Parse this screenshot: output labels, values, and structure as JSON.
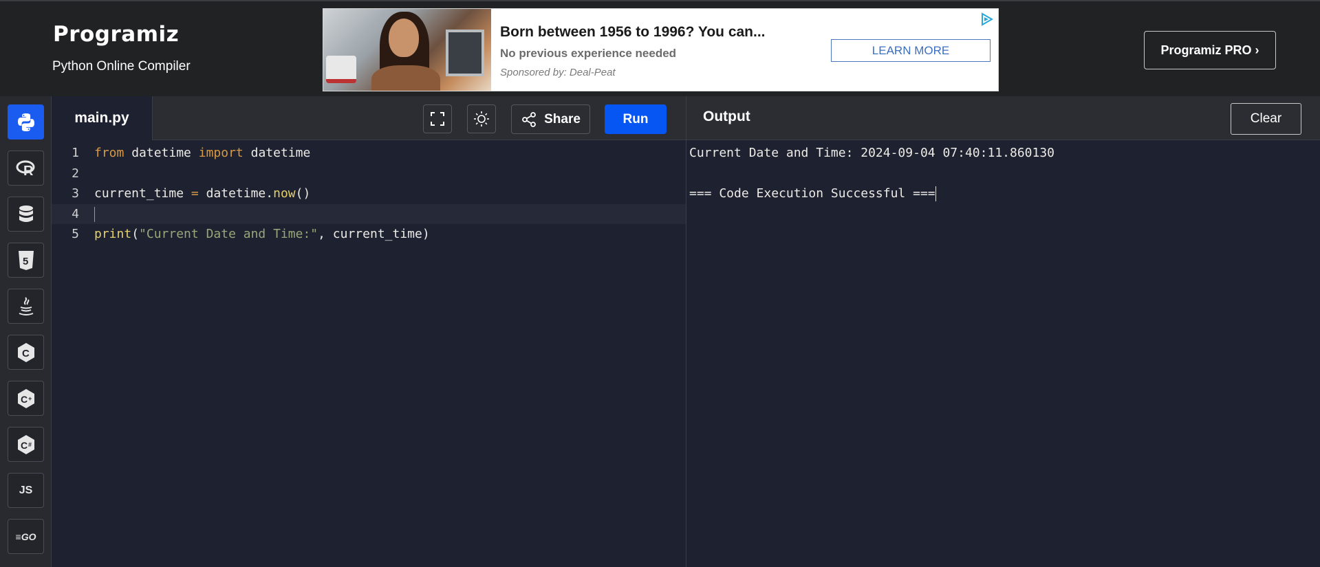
{
  "header": {
    "logo": "Programiz",
    "subtitle": "Python Online Compiler",
    "pro_button": "Programiz PRO ›"
  },
  "ad": {
    "headline": "Born between 1956 to 1996? You can...",
    "sub": "No previous experience needed",
    "sponsor": "Sponsored by: Deal-Peat",
    "cta": "LEARN MORE"
  },
  "sidebar": {
    "items": [
      {
        "icon": "python-icon",
        "active": true
      },
      {
        "icon": "r-language-icon"
      },
      {
        "icon": "database-icon"
      },
      {
        "icon": "html5-icon"
      },
      {
        "icon": "java-icon"
      },
      {
        "icon": "c-language-icon"
      },
      {
        "icon": "cpp-icon"
      },
      {
        "icon": "csharp-icon"
      },
      {
        "icon": "javascript-icon",
        "label": "JS"
      },
      {
        "icon": "go-icon",
        "label": "GO"
      }
    ]
  },
  "editor": {
    "tab": "main.py",
    "share_label": "Share",
    "run_label": "Run",
    "lines": [
      {
        "num": "1",
        "parts": [
          {
            "t": "kw",
            "v": "from"
          },
          {
            "t": "",
            "v": " datetime "
          },
          {
            "t": "kw",
            "v": "import"
          },
          {
            "t": "",
            "v": " datetime"
          }
        ]
      },
      {
        "num": "2",
        "parts": []
      },
      {
        "num": "3",
        "parts": [
          {
            "t": "",
            "v": "current_time "
          },
          {
            "t": "op",
            "v": "="
          },
          {
            "t": "",
            "v": " datetime."
          },
          {
            "t": "fn",
            "v": "now"
          },
          {
            "t": "",
            "v": "()"
          }
        ]
      },
      {
        "num": "4",
        "parts": [],
        "current": true
      },
      {
        "num": "5",
        "parts": [
          {
            "t": "fn",
            "v": "print"
          },
          {
            "t": "",
            "v": "("
          },
          {
            "t": "str",
            "v": "\"Current Date and Time:\""
          },
          {
            "t": "",
            "v": ", current_time)"
          }
        ]
      }
    ]
  },
  "output": {
    "title": "Output",
    "clear_label": "Clear",
    "lines": [
      "Current Date and Time: 2024-09-04 07:40:11.860130",
      "",
      "=== Code Execution Successful ==="
    ]
  },
  "colors": {
    "accent": "#0556f3",
    "background": "#1d2130",
    "header": "#212224",
    "keyword": "#d99a46",
    "function": "#e6d06a",
    "string": "#9aa67a"
  }
}
